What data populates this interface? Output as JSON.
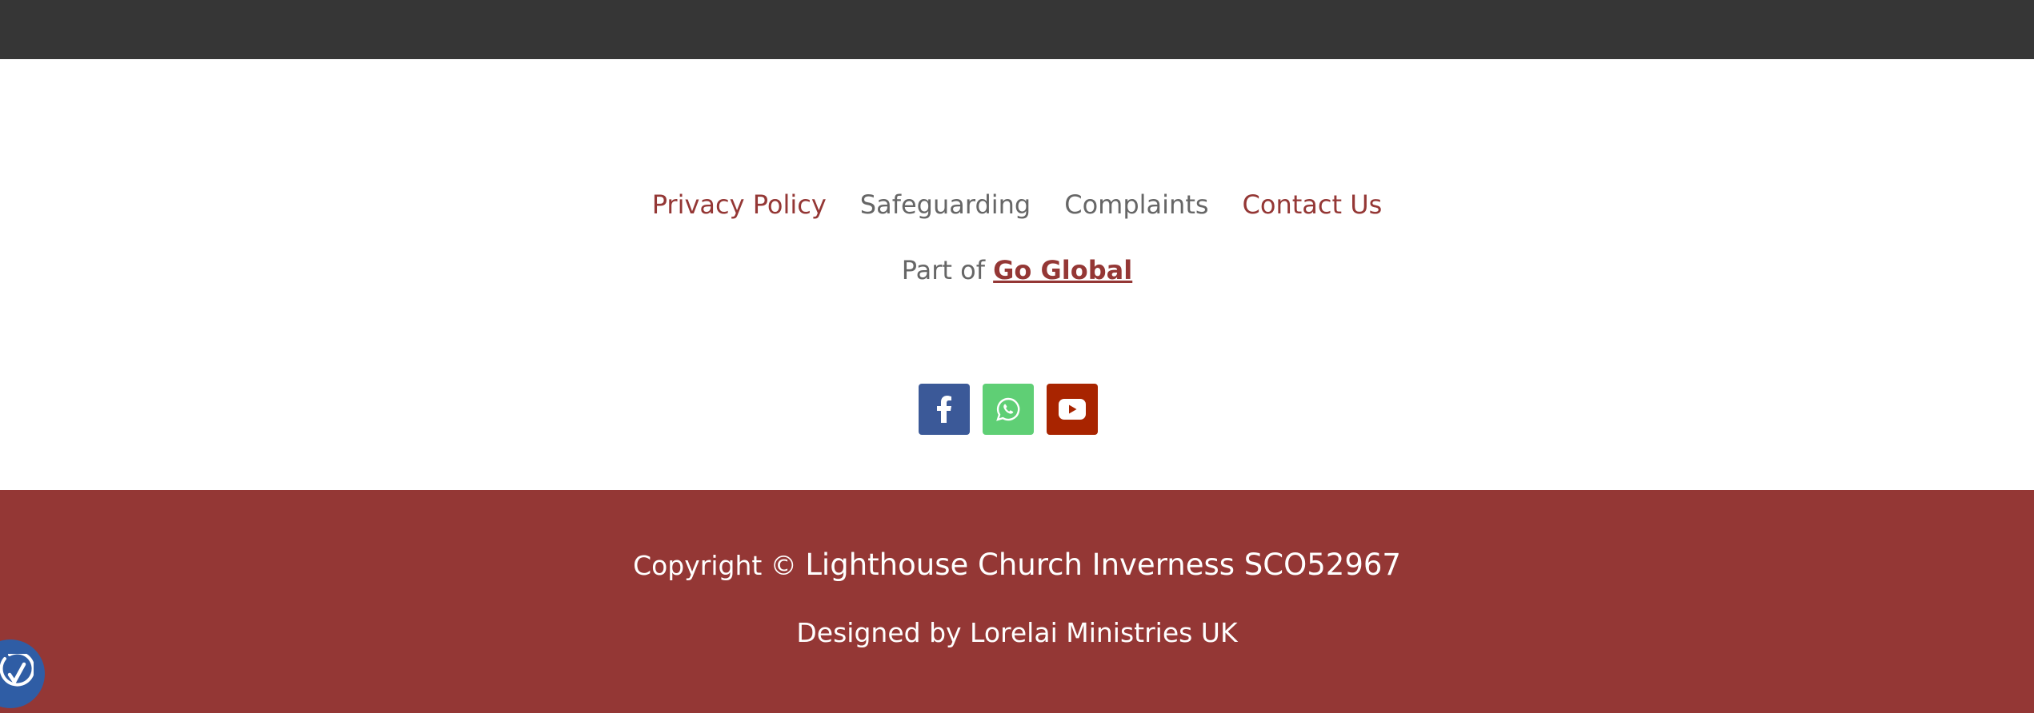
{
  "footer": {
    "links": [
      {
        "label": "Privacy Policy"
      },
      {
        "label": "Safeguarding"
      },
      {
        "label": "Complaints"
      },
      {
        "label": "Contact Us"
      }
    ],
    "part_of_prefix": "Part of",
    "part_of_link": "Go Global"
  },
  "social": [
    {
      "icon": "facebook-icon",
      "color": "#3b5998"
    },
    {
      "icon": "whatsapp-icon",
      "color": "#5fcf75"
    },
    {
      "icon": "youtube-icon",
      "color": "#a82400"
    }
  ],
  "bottom_bar": {
    "copyright_prefix": "Copyright ©",
    "organization": "Lighthouse Church Inverness SCO52967",
    "designed_by": "Designed by Lorelai Ministries UK"
  },
  "colors": {
    "top_bar": "#363636",
    "accent": "#943735",
    "muted_text": "#666666",
    "accessibility_widget": "#2f5da5"
  }
}
